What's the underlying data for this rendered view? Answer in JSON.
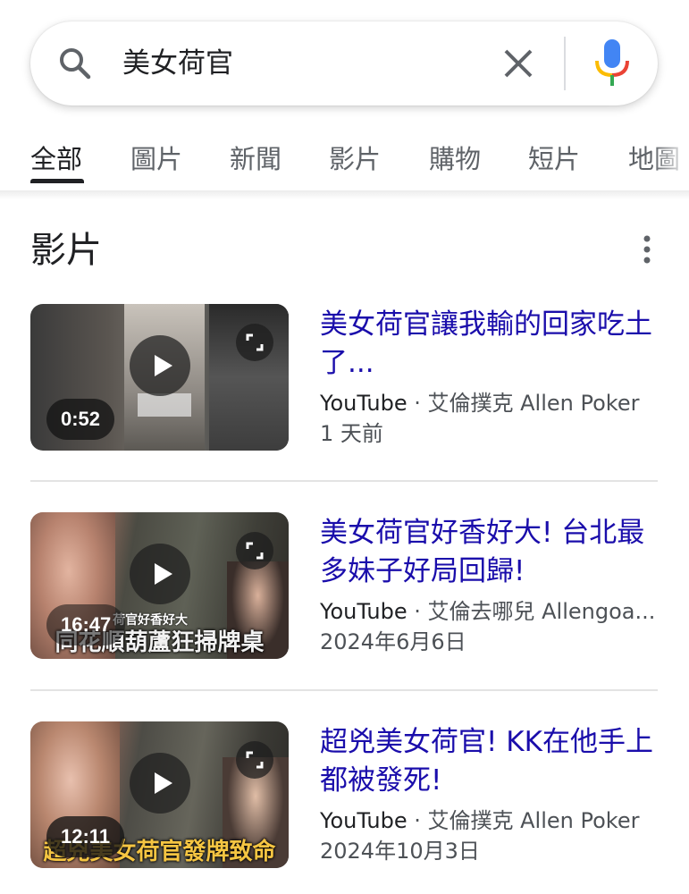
{
  "search": {
    "query": "美女荷官"
  },
  "tabs": [
    {
      "label": "全部",
      "active": true
    },
    {
      "label": "圖片",
      "active": false
    },
    {
      "label": "新聞",
      "active": false
    },
    {
      "label": "影片",
      "active": false
    },
    {
      "label": "購物",
      "active": false
    },
    {
      "label": "短片",
      "active": false
    },
    {
      "label": "地圖",
      "active": false
    }
  ],
  "section": {
    "title": "影片",
    "more_icon": "more-vert-icon"
  },
  "videos": [
    {
      "title": "美女荷官讓我輸的回家吃土了...",
      "source": "YouTube",
      "channel": "艾倫撲克 Allen Poker",
      "date": "1 天前",
      "duration": "0:52",
      "overlay_text": ""
    },
    {
      "title": "美女荷官好香好大! 台北最多妹子好局回歸!",
      "source": "YouTube",
      "channel": "艾倫去哪兒 Allengoa...",
      "date": "2024年6月6日",
      "duration": "16:47",
      "overlay_text": "同花順葫蘆狂掃牌桌",
      "overlay_small": "荷官好香好大"
    },
    {
      "title": "超兇美女荷官! KK在他手上都被發死!",
      "source": "YouTube",
      "channel": "艾倫撲克 Allen Poker",
      "date": "2024年10月3日",
      "duration": "12:11",
      "overlay_text": "超兇美女荷官發牌致命"
    }
  ],
  "colors": {
    "link": "#1a0dab",
    "text": "#202124",
    "meta": "#4d5156",
    "mic_blue": "#4285f4",
    "mic_red": "#ea4335",
    "mic_yellow": "#fbbc04",
    "mic_green": "#34a853"
  }
}
